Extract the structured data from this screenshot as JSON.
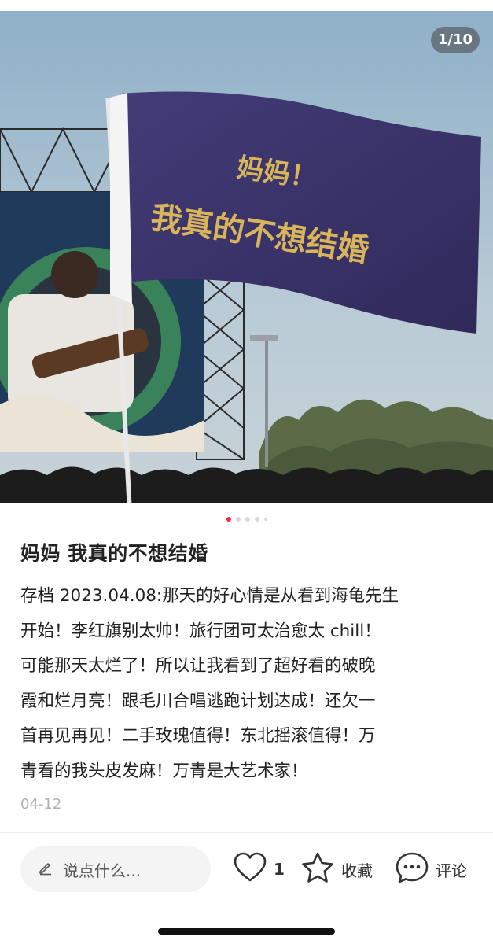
{
  "image": {
    "counter": "1/10",
    "flag_text_line1": "妈妈！",
    "flag_text_line2": "我真的不想结婚",
    "dots": [
      true,
      false,
      false,
      false,
      false
    ]
  },
  "post": {
    "title": "妈妈 我真的不想结婚",
    "body_lines": [
      "存档 2023.04.08:那天的好心情是从看到海龟先生",
      "开始！李红旗别太帅！旅行团可太治愈太 chill！",
      "可能那天太烂了！所以让我看到了超好看的破晚",
      "霞和烂月亮！跟毛川合唱逃跑计划达成！还欠一",
      "首再见再见！二手玫瑰值得！东北摇滚值得！万",
      "青看的我头皮发麻！万青是大艺术家！"
    ],
    "date": "04-12"
  },
  "bottom_bar": {
    "comment_placeholder": "说点什么...",
    "like_count": "1",
    "collect_label": "收藏",
    "comment_label": "评论"
  },
  "colors": {
    "accent": "#ff2442",
    "flag": "#3b3569",
    "flag_text": "#d8b45a",
    "sky": "#9ab6cc"
  },
  "icons": [
    "pencil-icon",
    "heart-icon",
    "star-icon",
    "comment-bubble-icon"
  ]
}
